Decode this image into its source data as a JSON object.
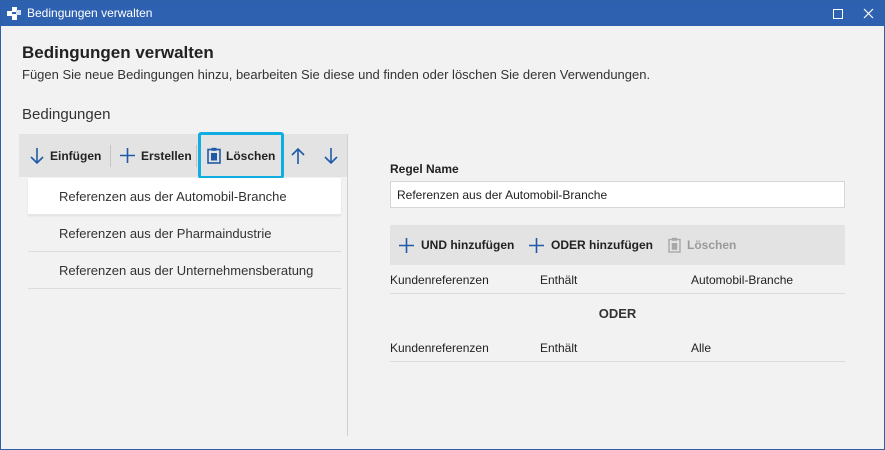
{
  "window": {
    "title": "Bedingungen verwalten",
    "icons": {
      "app": "app-icon",
      "maximize": "maximize-icon",
      "close": "close-icon"
    }
  },
  "header": {
    "title": "Bedingungen verwalten",
    "subtitle": "Fügen Sie neue Bedingungen hinzu, bearbeiten Sie diese und finden oder löschen Sie deren Verwendungen."
  },
  "conditions": {
    "section_title": "Bedingungen",
    "toolbar": {
      "insert_label": "Einfügen",
      "create_label": "Erstellen",
      "delete_label": "Löschen",
      "move_up_icon": "arrow-up-icon",
      "move_down_icon": "arrow-down-icon"
    },
    "items": [
      {
        "label": "Referenzen aus der Automobil-Branche",
        "selected": true
      },
      {
        "label": "Referenzen aus der Pharmaindustrie",
        "selected": false
      },
      {
        "label": "Referenzen aus der Unternehmensberatung",
        "selected": false
      }
    ]
  },
  "rule": {
    "name_label": "Regel Name",
    "name_value": "Referenzen aus der Automobil-Branche",
    "toolbar": {
      "and_label": "UND hinzufügen",
      "or_label": "ODER hinzufügen",
      "delete_label": "Löschen"
    },
    "rows": [
      {
        "field": "Kundenreferenzen",
        "operator": "Enthält",
        "value": "Automobil-Branche"
      },
      {
        "field": "Kundenreferenzen",
        "operator": "Enthält",
        "value": "Alle"
      }
    ],
    "separator": "ODER"
  },
  "colors": {
    "titlebar": "#2e62b0",
    "accent_highlight": "#10aee0",
    "icon_blue": "#1e5aa8",
    "background": "#f2f2f2",
    "toolbar": "#e3e3e3"
  }
}
